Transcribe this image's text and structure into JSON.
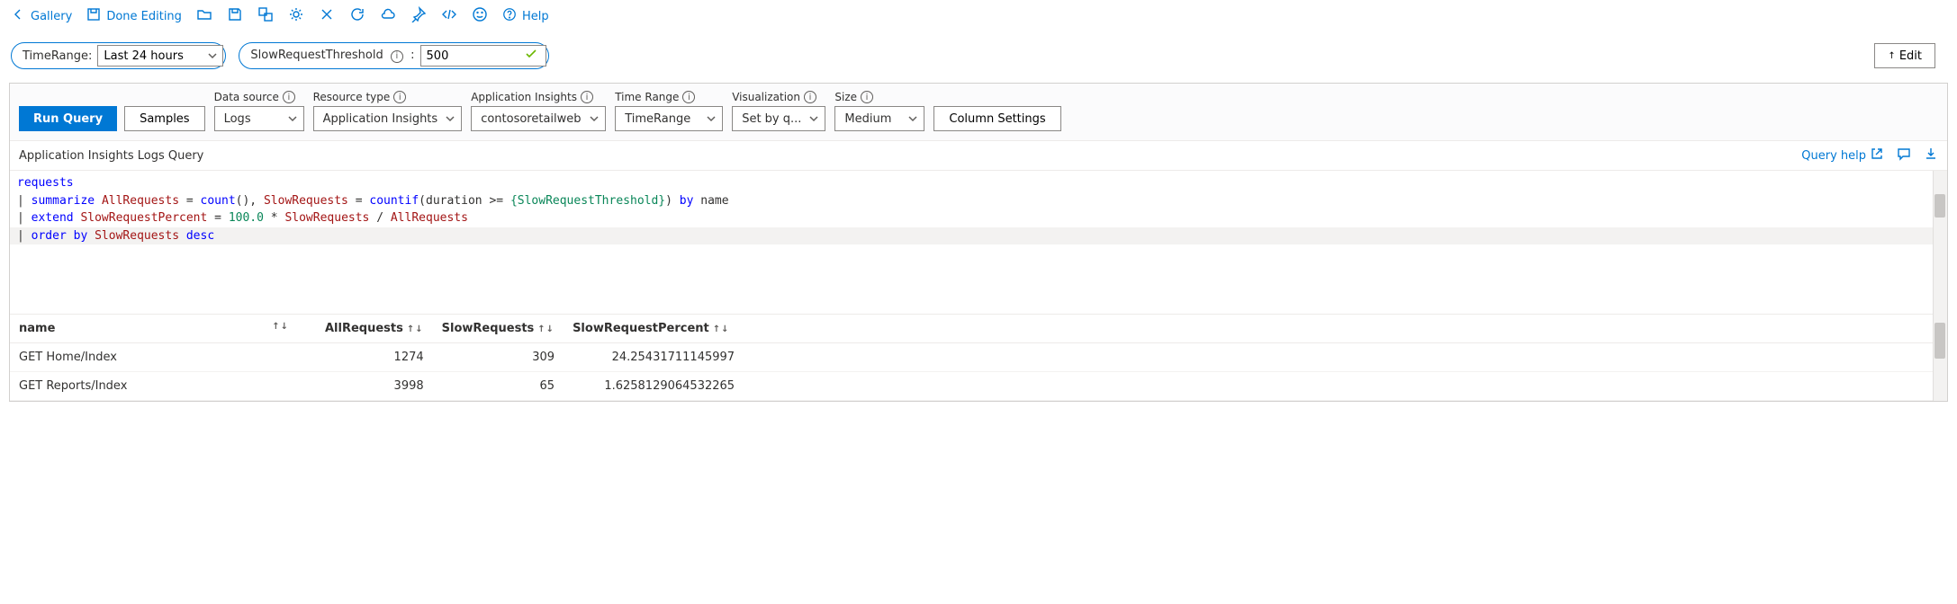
{
  "toolbar": {
    "gallery_label": "Gallery",
    "done_editing_label": "Done Editing",
    "help_label": "Help"
  },
  "params": {
    "time_range_label": "TimeRange:",
    "time_range_value": "Last 24 hours",
    "slow_threshold_label": "SlowRequestThreshold",
    "slow_threshold_value": "500"
  },
  "top_actions": {
    "edit_label": "Edit"
  },
  "config": {
    "run_label": "Run Query",
    "samples_label": "Samples",
    "data_source_label": "Data source",
    "data_source_value": "Logs",
    "resource_type_label": "Resource type",
    "resource_type_value": "Application Insights",
    "app_insights_label": "Application Insights",
    "app_insights_value": "contosoretailweb",
    "time_range_label": "Time Range",
    "time_range_value": "TimeRange",
    "visualization_label": "Visualization",
    "visualization_value": "Set by q...",
    "size_label": "Size",
    "size_value": "Medium",
    "column_settings_label": "Column Settings"
  },
  "query_header": {
    "title": "Application Insights Logs Query",
    "help_label": "Query help"
  },
  "code": {
    "line1_table": "requests",
    "l2_pipe": "| ",
    "l2_summarize": "summarize ",
    "l2_col1": "AllRequests",
    "l2_eq1": " = ",
    "l2_fn1": "count",
    "l2_paren1": "(), ",
    "l2_col2": "SlowRequests",
    "l2_eq2": " = ",
    "l2_fn2": "countif",
    "l2_paren2_open": "(",
    "l2_dur": "duration",
    "l2_cmp": " >= ",
    "l2_param": "{SlowRequestThreshold}",
    "l2_paren2_close": ") ",
    "l2_by": "by ",
    "l2_name": "name",
    "l3_pipe": "| ",
    "l3_extend": "extend ",
    "l3_col": "SlowRequestPercent",
    "l3_eq": " = ",
    "l3_num": "100.0",
    "l3_mul": " * ",
    "l3_c1": "SlowRequests",
    "l3_div": " / ",
    "l3_c2": "AllRequests",
    "l4_pipe": "| ",
    "l4_order": "order by ",
    "l4_col": "SlowRequests",
    "l4_dir": " desc"
  },
  "table": {
    "columns": {
      "name": "name",
      "all": "AllRequests",
      "slow": "SlowRequests",
      "pct": "SlowRequestPercent"
    },
    "rows": [
      {
        "name": "GET Home/Index",
        "all": "1274",
        "slow": "309",
        "pct": "24.25431711145997"
      },
      {
        "name": "GET Reports/Index",
        "all": "3998",
        "slow": "65",
        "pct": "1.6258129064532265"
      }
    ]
  }
}
